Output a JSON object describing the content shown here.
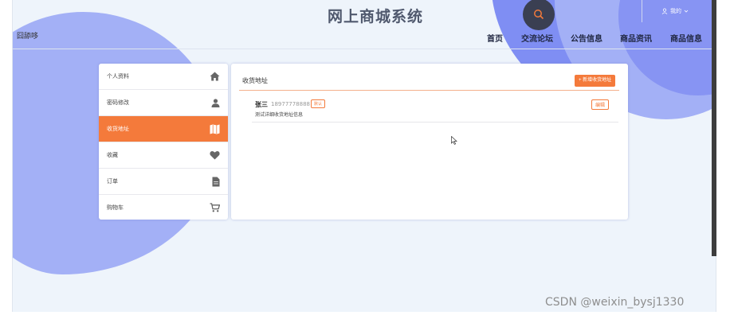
{
  "header": {
    "brand": "网上商城系统",
    "user_id": "囧舔哆",
    "mine_label": "我的",
    "nav": [
      "首页",
      "交流论坛",
      "公告信息",
      "商品资讯",
      "商品信息"
    ]
  },
  "sidebar": {
    "items": [
      {
        "label": "个人资料",
        "icon": "home-icon",
        "active": false
      },
      {
        "label": "密码修改",
        "icon": "user-icon",
        "active": false
      },
      {
        "label": "收货地址",
        "icon": "map-icon",
        "active": true
      },
      {
        "label": "收藏",
        "icon": "heart-icon",
        "active": false
      },
      {
        "label": "订单",
        "icon": "document-icon",
        "active": false
      },
      {
        "label": "购物车",
        "icon": "cart-icon",
        "active": false
      }
    ]
  },
  "main": {
    "title": "收货地址",
    "add_button": "+ 新增收货地址",
    "addresses": [
      {
        "name": "张三",
        "phone": "18977778888",
        "badge": "默认",
        "detail": "测试详细收货地址信息",
        "edit": "编辑"
      }
    ]
  },
  "colors": {
    "accent": "#f47a3b",
    "blob_light": "#a3b0f6",
    "blob_dark": "#7f8ef3"
  },
  "watermark": "CSDN @weixin_bysj1330"
}
